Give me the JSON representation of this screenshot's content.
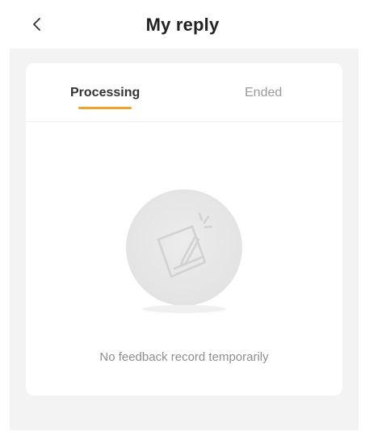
{
  "header": {
    "back_icon": "chevron-left-icon",
    "title": "My reply"
  },
  "tabs": [
    {
      "label": "Processing",
      "active": true
    },
    {
      "label": "Ended",
      "active": false
    }
  ],
  "empty_state": {
    "icon": "edit-note-icon",
    "message": "No feedback record temporarily"
  },
  "colors": {
    "accent": "#f0a32a",
    "background": "#f3f3f3",
    "card": "#ffffff"
  }
}
